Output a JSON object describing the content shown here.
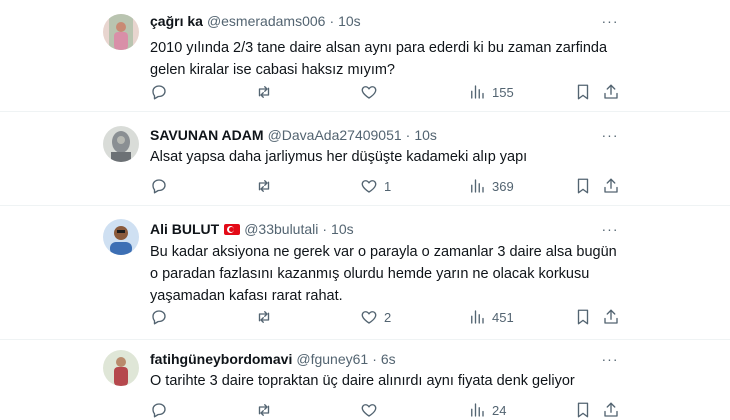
{
  "tweets": [
    {
      "name": "çağrı ka",
      "handle": "@esmeradams006",
      "time": "10s",
      "text": "2010 yılında 2/3 tane daire alsan aynı para ederdi ki bu zaman zarfinda gelen kiralar ise cabasi haksız mıyım?",
      "replies": "",
      "retweets": "",
      "likes": "",
      "views": "155",
      "avatar_color": "#d98fa8"
    },
    {
      "name": "SAVUNAN ADAM",
      "handle": "@DavaAda27409051",
      "time": "10s",
      "text": "Alsat yapsa daha jarliymus her düşüşte kadameki alıp yapı",
      "replies": "",
      "retweets": "",
      "likes": "1",
      "views": "369",
      "avatar_color": "#8a8f93"
    },
    {
      "name": "Ali BULUT",
      "handle": "@33bulutali",
      "time": "10s",
      "text": "Bu kadar aksiyona ne gerek var o parayla o zamanlar 3 daire alsa bugün o paradan fazlasını kazanmış olurdu hemde yarın ne olacak korkusu yaşamadan kafası rarat rahat.",
      "replies": "",
      "retweets": "",
      "likes": "2",
      "views": "451",
      "avatar_color": "#3d6fb4",
      "flag": true
    },
    {
      "name": "fatihgüneybordomavi",
      "handle": "@fguney61",
      "time": "6s",
      "text": "O tarihte 3 daire topraktan üç daire alınırdı aynı fiyata denk geliyor",
      "replies": "",
      "retweets": "",
      "likes": "",
      "views": "24",
      "avatar_color": "#b5484d"
    }
  ],
  "ui": {
    "separator": "·",
    "more_label": "···"
  }
}
